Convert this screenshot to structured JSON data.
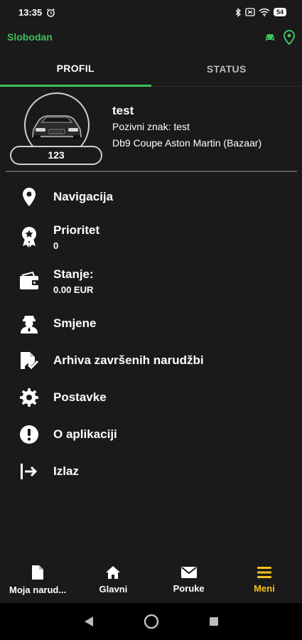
{
  "status_bar": {
    "time": "13:35",
    "battery": "54"
  },
  "header": {
    "driver_name": "Slobodan",
    "accent_color": "#3fbf5a"
  },
  "tabs": [
    {
      "label": "PROFIL",
      "active": true
    },
    {
      "label": "STATUS",
      "active": false
    }
  ],
  "profile": {
    "name": "test",
    "call_sign": "Pozivni znak: test",
    "car": "Db9 Coupe Aston Martin (Bazaar)",
    "number": "123"
  },
  "menu": {
    "navigacija": {
      "label": "Navigacija",
      "icon": "location-pin-icon"
    },
    "prioritet": {
      "label": "Prioritet",
      "value": "0",
      "icon": "badge-icon"
    },
    "stanje": {
      "label": "Stanje:",
      "value": "0.00 EUR",
      "icon": "wallet-icon"
    },
    "smjene": {
      "label": "Smjene",
      "icon": "driver-icon"
    },
    "arhiva": {
      "label": "Arhiva završenih narudžbi",
      "icon": "archive-check-icon"
    },
    "postavke": {
      "label": "Postavke",
      "icon": "gear-icon"
    },
    "o_aplikaciji": {
      "label": "O aplikaciji",
      "icon": "info-alert-icon"
    },
    "izlaz": {
      "label": "Izlaz",
      "icon": "logout-icon"
    }
  },
  "bottom_nav": [
    {
      "label": "Moja narud...",
      "icon": "document-icon",
      "active": false
    },
    {
      "label": "Glavni",
      "icon": "home-icon",
      "active": false
    },
    {
      "label": "Poruke",
      "icon": "mail-icon",
      "active": false
    },
    {
      "label": "Meni",
      "icon": "menu-icon",
      "active": true
    }
  ],
  "colors": {
    "background": "#1a1a1a",
    "active_nav": "#f2c21a"
  }
}
